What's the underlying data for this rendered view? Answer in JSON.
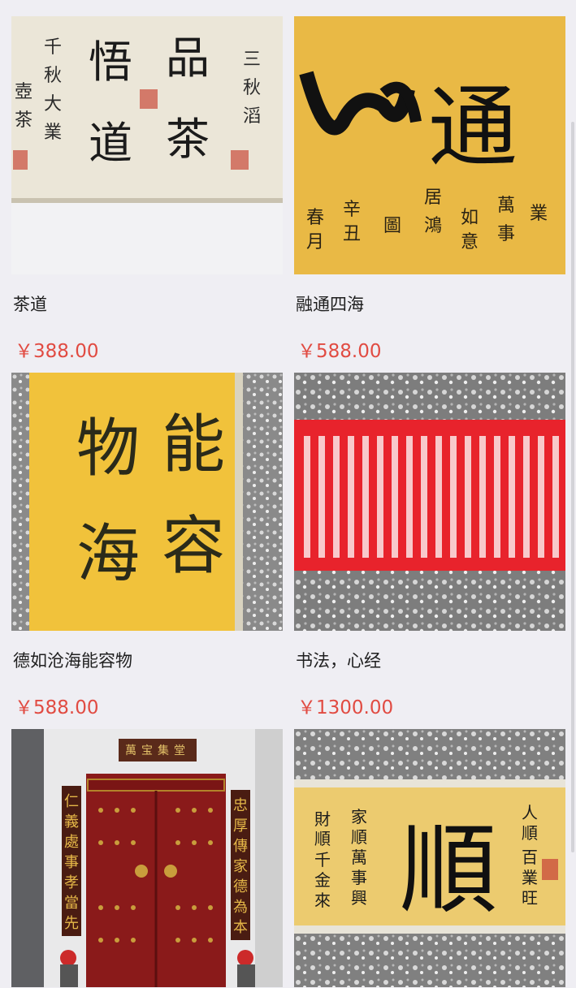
{
  "products": [
    {
      "title": "茶道",
      "price": "￥388.00",
      "art": {
        "kind": "scroll-horizontal",
        "bg": "#ebe6d8",
        "chars": [
          "品",
          "茶",
          "悟",
          "道"
        ]
      }
    },
    {
      "title": "融通四海",
      "price": "￥588.00",
      "art": {
        "kind": "gold-paper",
        "bg": "#e9b945",
        "chars": [
          "四",
          "通"
        ]
      }
    },
    {
      "title": "德如沧海能容物",
      "price": "￥588.00",
      "art": {
        "kind": "gold-vertical",
        "bg": "#f1c23b",
        "chars": [
          "能",
          "容",
          "物",
          "海"
        ]
      }
    },
    {
      "title": "书法，心经",
      "price": "￥1300.00",
      "art": {
        "kind": "red-sutra",
        "bg": "#e8232c"
      }
    },
    {
      "title": "",
      "price": "",
      "art": {
        "kind": "door",
        "bg": "#8a1a1a",
        "couplet_left": [
          "仁",
          "義",
          "處",
          "事",
          "孝",
          "當",
          "先"
        ],
        "couplet_right": [
          "忠",
          "厚",
          "傳",
          "家",
          "德",
          "為",
          "本"
        ],
        "plaque": "萬宝集堂"
      }
    },
    {
      "title": "",
      "price": "",
      "art": {
        "kind": "scroll-gold",
        "bg": "#eccb6f",
        "chars": [
          "順"
        ]
      }
    }
  ]
}
